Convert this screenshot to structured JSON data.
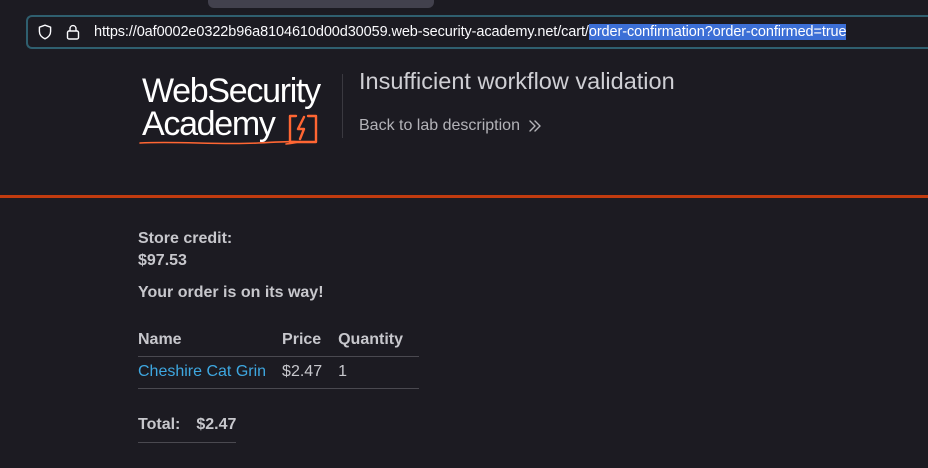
{
  "browser": {
    "url_prefix": "https://0af0002e0322b96a8104610d00d30059.web-security-academy.net/cart/",
    "url_selected": "order-confirmation?order-confirmed=true",
    "icons": {
      "shield": "shield-icon",
      "lock": "lock-icon"
    }
  },
  "header": {
    "logo": {
      "line1": "WebSecurity",
      "line2": "Academy"
    },
    "lab_title": "Insufficient workflow validation",
    "back_link": "Back to lab description",
    "accent_color": "#c13b0f"
  },
  "store": {
    "credit_label": "Store credit:",
    "credit_value": "$97.53",
    "order_message": "Your order is on its way!"
  },
  "order_table": {
    "columns": [
      "Name",
      "Price",
      "Quantity"
    ],
    "rows": [
      {
        "name": "Cheshire Cat Grin",
        "price": "$2.47",
        "quantity": "1"
      }
    ]
  },
  "total": {
    "label": "Total:",
    "value": "$2.47"
  },
  "colors": {
    "background": "#1c1b22",
    "link": "#3ea7e0",
    "selection": "#3c6fd6",
    "url_focus_border": "#2f5f6f"
  }
}
